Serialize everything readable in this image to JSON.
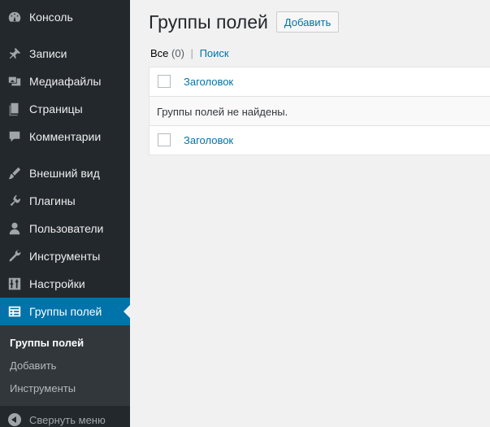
{
  "sidebar": {
    "items": [
      {
        "label": "Консоль",
        "icon": "dashboard-icon"
      },
      {
        "label": "Записи",
        "icon": "pin-icon"
      },
      {
        "label": "Медиафайлы",
        "icon": "media-icon"
      },
      {
        "label": "Страницы",
        "icon": "pages-icon"
      },
      {
        "label": "Комментарии",
        "icon": "comment-icon"
      },
      {
        "label": "Внешний вид",
        "icon": "brush-icon"
      },
      {
        "label": "Плагины",
        "icon": "plugin-icon"
      },
      {
        "label": "Пользователи",
        "icon": "user-icon"
      },
      {
        "label": "Инструменты",
        "icon": "wrench-icon"
      },
      {
        "label": "Настройки",
        "icon": "settings-icon"
      },
      {
        "label": "Группы полей",
        "icon": "field-groups-icon"
      }
    ],
    "submenu": [
      {
        "label": "Группы полей"
      },
      {
        "label": "Добавить"
      },
      {
        "label": "Инструменты"
      }
    ],
    "collapse_label": "Свернуть меню"
  },
  "main": {
    "title": "Группы полей",
    "add_button": "Добавить",
    "filter": {
      "all_label": "Все",
      "all_count": "(0)",
      "separator": "|",
      "search_label": "Поиск"
    },
    "table": {
      "header_title": "Заголовок",
      "empty_message": "Группы полей не найдены.",
      "footer_title": "Заголовок"
    }
  },
  "colors": {
    "sidebar_bg": "#23282d",
    "active_bg": "#0073aa",
    "link": "#0073aa",
    "page_bg": "#f1f1f1"
  }
}
